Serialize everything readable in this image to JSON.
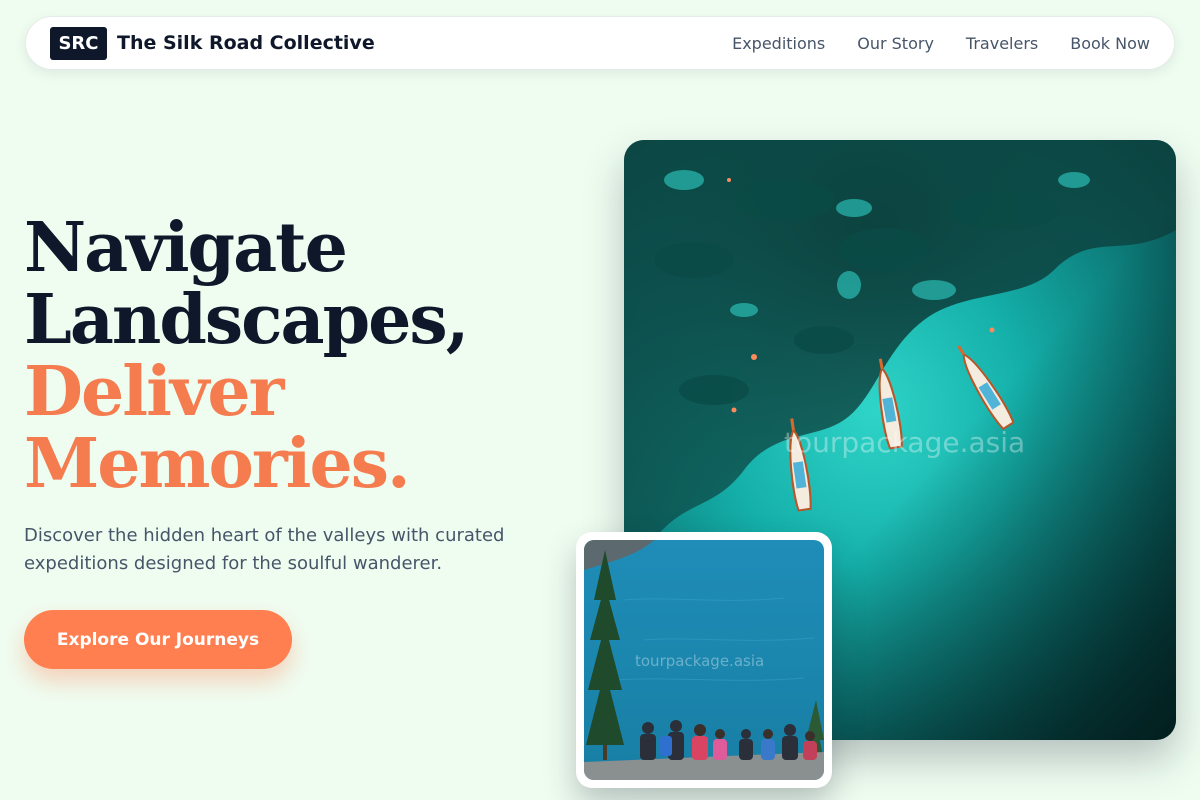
{
  "brand": {
    "logo_text": "SRC",
    "name": "The Silk Road Collective"
  },
  "nav": {
    "links": [
      "Expeditions",
      "Our Story",
      "Travelers",
      "Book Now"
    ]
  },
  "hero": {
    "headline_line1": "Navigate",
    "headline_line2": "Landscapes,",
    "headline_line3": "Deliver",
    "headline_line4": "Memories.",
    "subtext": "Discover the hidden heart of the valleys with curated expeditions designed for the soulful wanderer.",
    "cta_label": "Explore Our Journeys"
  },
  "images": {
    "main_watermark": "tourpackage.asia",
    "card_watermark": "tourpackage.asia"
  },
  "colors": {
    "background": "#effdf1",
    "dark": "#0f172a",
    "accent": "#ff7f50",
    "accent_text": "#f47c4f",
    "muted": "#475569"
  }
}
